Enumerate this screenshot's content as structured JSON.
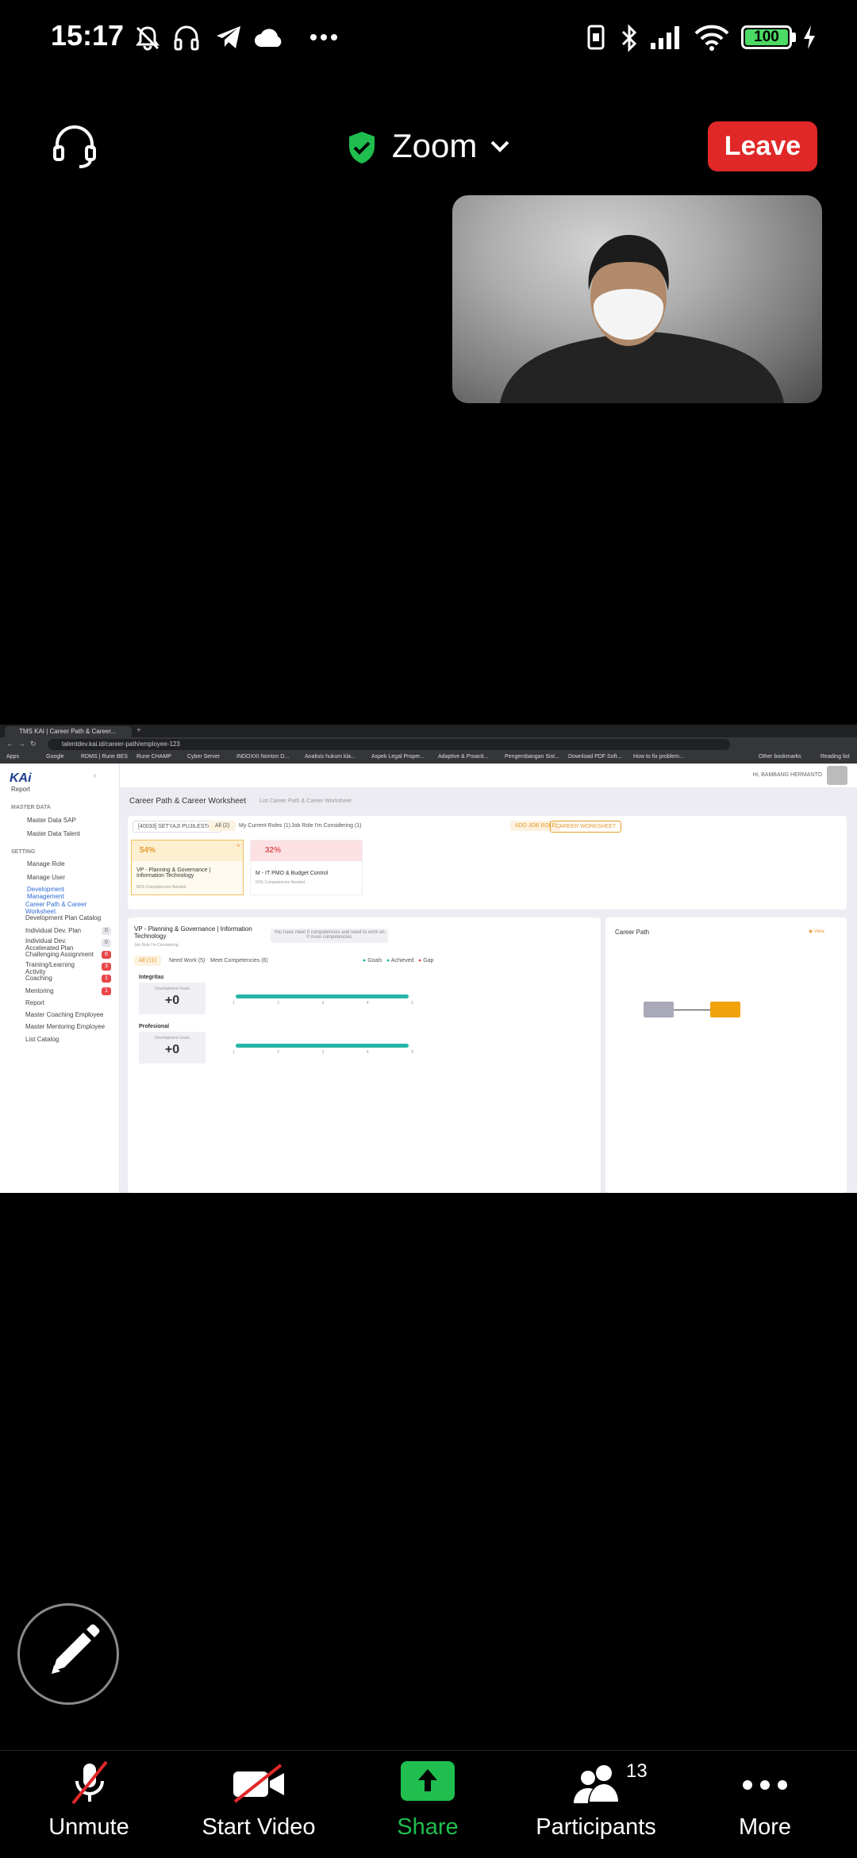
{
  "status_bar": {
    "time": "15:17",
    "battery": "100"
  },
  "meeting": {
    "title": "Zoom",
    "leave_label": "Leave"
  },
  "shared_screen": {
    "browser": {
      "tab_title": "TMS KAI | Career Path & Career...",
      "url": "talentdev.kai.id/career-path/employee-123",
      "bookmarks": [
        "Apps",
        "Google",
        "RDMS | Rune BES",
        "Rune CHAMP",
        "Cyber Server",
        "INDOXXI Nonton D...",
        "Analisis hukum kla...",
        "Aspek Legal Proper...",
        "Adaptive & Proacti...",
        "Pengembangan Sist...",
        "Download PDF Soft...",
        "How to fix problem...",
        "Other bookmarks",
        "Reading list"
      ]
    },
    "app": {
      "logo": "KAi",
      "user": "Hi, BAMBANG HERMANTO",
      "sidebar": {
        "report_top": "Report",
        "master_data_header": "MASTER DATA",
        "master_data_sap": "Master Data SAP",
        "master_data_talent": "Master Data Talent",
        "setting_header": "SETTING",
        "manage_role": "Manage Role",
        "manage_user": "Manage User",
        "development_management": "Development Management",
        "career_path": "Career Path & Career Worksheet",
        "items": [
          {
            "label": "Development Plan Catalog",
            "badge": ""
          },
          {
            "label": "Individual Dev. Plan",
            "badge": "0"
          },
          {
            "label": "Individual Dev. Accelerated Plan",
            "badge": "0"
          },
          {
            "label": "Challenging Assignment",
            "badge": "8"
          },
          {
            "label": "Training/Learning Activity",
            "badge": "3"
          },
          {
            "label": "Coaching",
            "badge": "1"
          },
          {
            "label": "Mentoring",
            "badge": "1"
          },
          {
            "label": "Report",
            "badge": ""
          },
          {
            "label": "Master Coaching Employee",
            "badge": ""
          },
          {
            "label": "Master Mentoring Employee",
            "badge": ""
          },
          {
            "label": "List Catalog",
            "badge": ""
          }
        ]
      },
      "page_title": "Career Path & Career Worksheet",
      "breadcrumb": "List Career Path & Career Worksheet",
      "employee_select": "[40033] SETYAJI PUJILESTARI",
      "filters": {
        "all": "All (2)",
        "current": "My Current Roles (1)",
        "considering": "Job Role I'm Considering (1)"
      },
      "buttons": {
        "add_job_role": "ADD JOB ROLE",
        "career_worksheet": "CAREER WORKSHEET"
      },
      "role_cards": [
        {
          "percent": "54%",
          "title": "VP - Planning & Governance | Information Technology",
          "subtitle": "82% Competencies Needed"
        },
        {
          "percent": "32%",
          "title": "M - IT PMO & Budget Control",
          "subtitle": "62% Competencies Needed"
        }
      ],
      "detail": {
        "title": "VP - Planning & Governance | Information Technology",
        "subtitle": "Job Role I'm Considering",
        "notice": "You have meet 0 competencies and need to work on 0 more competencies",
        "tabs": [
          "All (11)",
          "Need Work (5)",
          "Meet Competencies (6)"
        ],
        "legend": {
          "goals": "Goals",
          "achieved": "Achieved",
          "gap": "Gap"
        },
        "competencies": [
          {
            "name": "Integritas",
            "gap_label": "Development Goals",
            "gap_value": "+0",
            "scale": [
              "1",
              "2",
              "3",
              "4",
              "5"
            ]
          },
          {
            "name": "Profesional",
            "gap_label": "Development Goals",
            "gap_value": "+0",
            "scale": [
              "1",
              "2",
              "3",
              "4",
              "5"
            ]
          }
        ]
      },
      "career_path": {
        "title": "Career Path",
        "view": "View"
      }
    }
  },
  "toolbar": {
    "unmute": "Unmute",
    "start_video": "Start Video",
    "share": "Share",
    "participants": "Participants",
    "participants_count": "13",
    "more": "More"
  },
  "colors": {
    "leave": "#e02828",
    "share": "#1fbe4f",
    "shield": "#1fbe4f",
    "accent": "#f5a623"
  }
}
